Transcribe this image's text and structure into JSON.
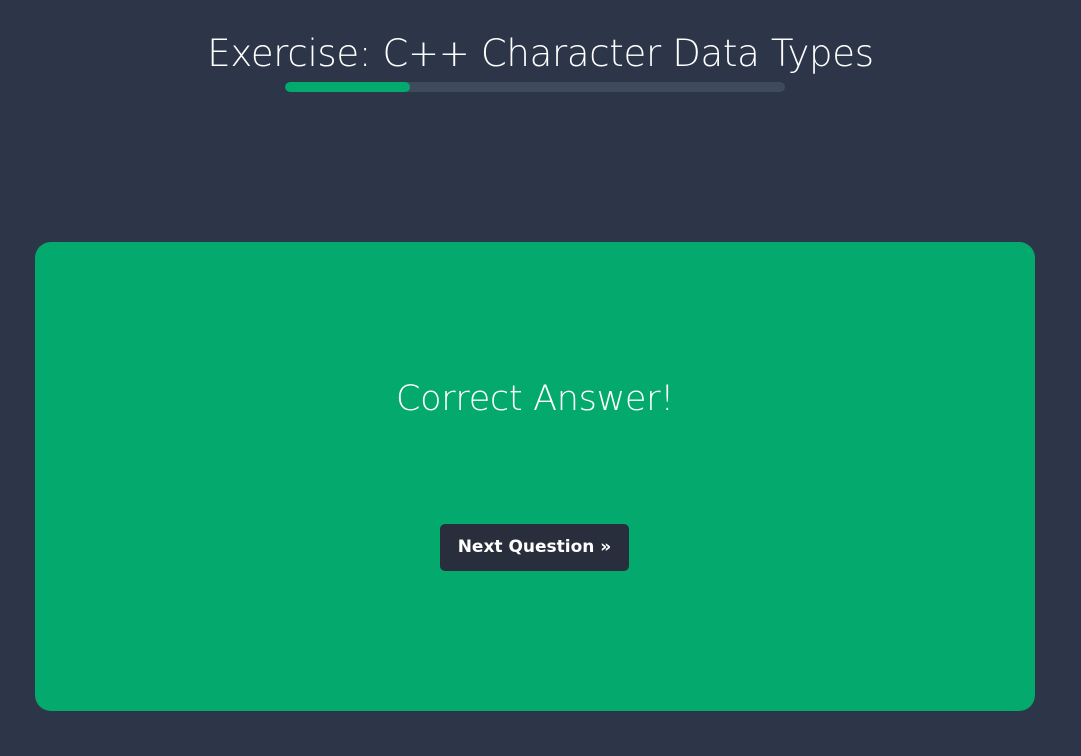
{
  "header": {
    "title": "Exercise: C++ Character Data Types"
  },
  "progress": {
    "fraction": 0.25,
    "track_color": "#3f4a5c",
    "fill_color": "#04aa6d"
  },
  "result": {
    "message": "Correct Answer!",
    "panel_color": "#04aa6d",
    "next_button_label": "Next Question »"
  },
  "colors": {
    "page_background": "#2d3649",
    "button_background": "#282e3b",
    "text": "#ffffff"
  }
}
